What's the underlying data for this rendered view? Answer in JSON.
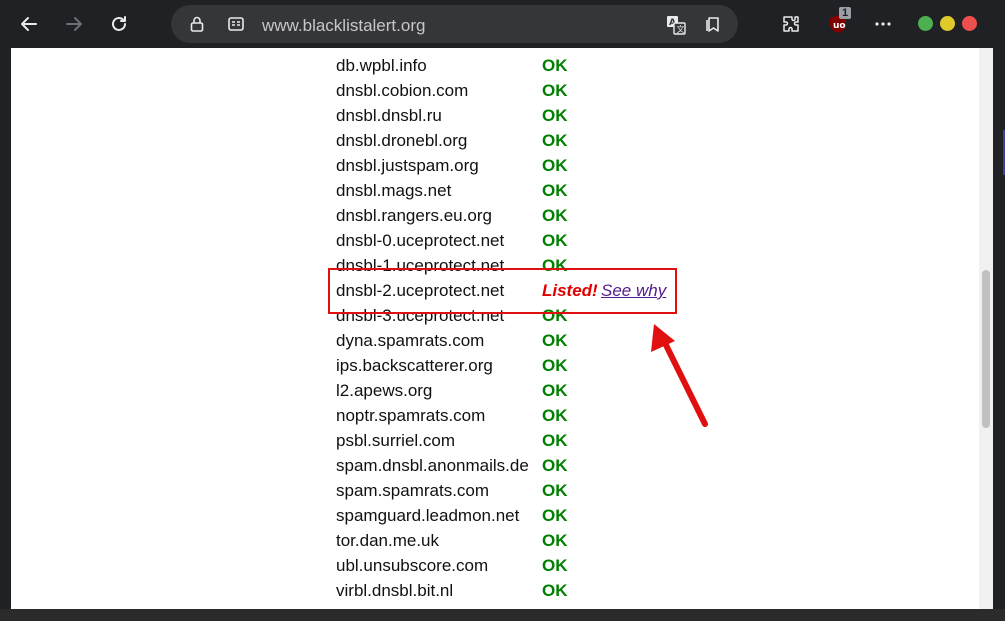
{
  "browser": {
    "url": "www.blacklistalert.org",
    "extension_badge": "1",
    "colors": {
      "close": "#ed4f4f",
      "minimize": "#4caf50",
      "maximize": "#e0c92b"
    }
  },
  "results": [
    {
      "host": "db.wpbl.info",
      "status": "OK"
    },
    {
      "host": "dnsbl.cobion.com",
      "status": "OK"
    },
    {
      "host": "dnsbl.dnsbl.ru",
      "status": "OK"
    },
    {
      "host": "dnsbl.dronebl.org",
      "status": "OK"
    },
    {
      "host": "dnsbl.justspam.org",
      "status": "OK"
    },
    {
      "host": "dnsbl.mags.net",
      "status": "OK"
    },
    {
      "host": "dnsbl.rangers.eu.org",
      "status": "OK"
    },
    {
      "host": "dnsbl-0.uceprotect.net",
      "status": "OK"
    },
    {
      "host": "dnsbl-1.uceprotect.net",
      "status": "OK"
    },
    {
      "host": "dnsbl-2.uceprotect.net",
      "status": "Listed!",
      "link": "See why"
    },
    {
      "host": "dnsbl-3.uceprotect.net",
      "status": "OK"
    },
    {
      "host": "dyna.spamrats.com",
      "status": "OK"
    },
    {
      "host": "ips.backscatterer.org",
      "status": "OK"
    },
    {
      "host": "l2.apews.org",
      "status": "OK"
    },
    {
      "host": "noptr.spamrats.com",
      "status": "OK"
    },
    {
      "host": "psbl.surriel.com",
      "status": "OK"
    },
    {
      "host": "spam.dnsbl.anonmails.de",
      "status": "OK"
    },
    {
      "host": "spam.spamrats.com",
      "status": "OK"
    },
    {
      "host": "spamguard.leadmon.net",
      "status": "OK"
    },
    {
      "host": "tor.dan.me.uk",
      "status": "OK"
    },
    {
      "host": "ubl.unsubscore.com",
      "status": "OK"
    },
    {
      "host": "virbl.dnsbl.bit.nl",
      "status": "OK"
    }
  ],
  "colors": {
    "ok": "#008000",
    "listed": "#e00000",
    "link": "#551a8b",
    "highlight": "#e01010"
  }
}
